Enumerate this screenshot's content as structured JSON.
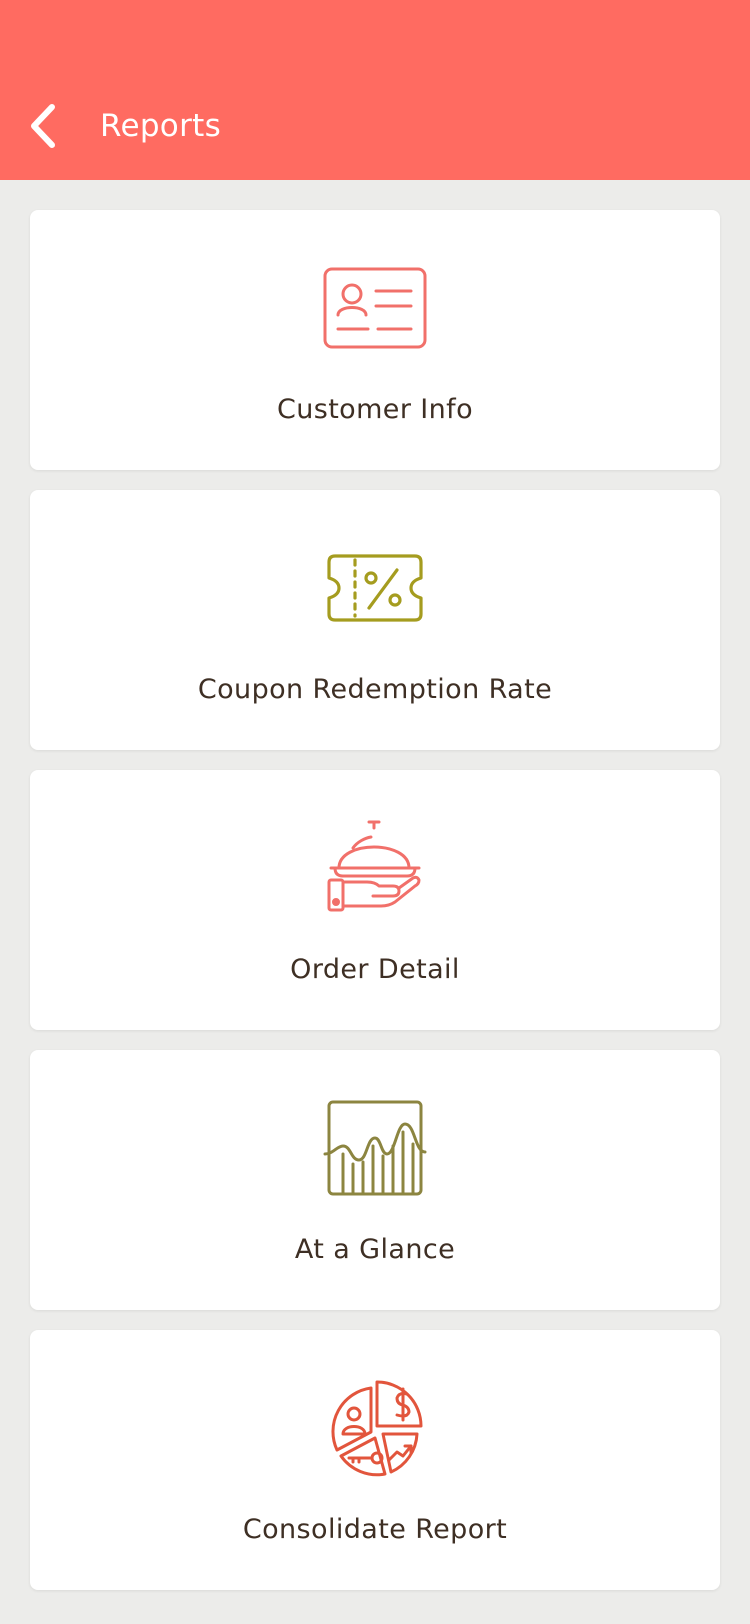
{
  "header": {
    "title": "Reports",
    "back_icon": "chevron-left-icon",
    "background_color": "#ff6b61"
  },
  "reports": [
    {
      "label": "Customer Info",
      "icon": "id-card-icon",
      "color": "#f1706a"
    },
    {
      "label": "Coupon Redemption Rate",
      "icon": "coupon-percent-icon",
      "color": "#a59c1f"
    },
    {
      "label": "Order Detail",
      "icon": "serving-cloche-icon",
      "color": "#f1706a"
    },
    {
      "label": "At a Glance",
      "icon": "analytics-chart-icon",
      "color": "#8c8540"
    },
    {
      "label": "Consolidate Report",
      "icon": "pie-chart-report-icon",
      "color": "#e2553c"
    }
  ]
}
